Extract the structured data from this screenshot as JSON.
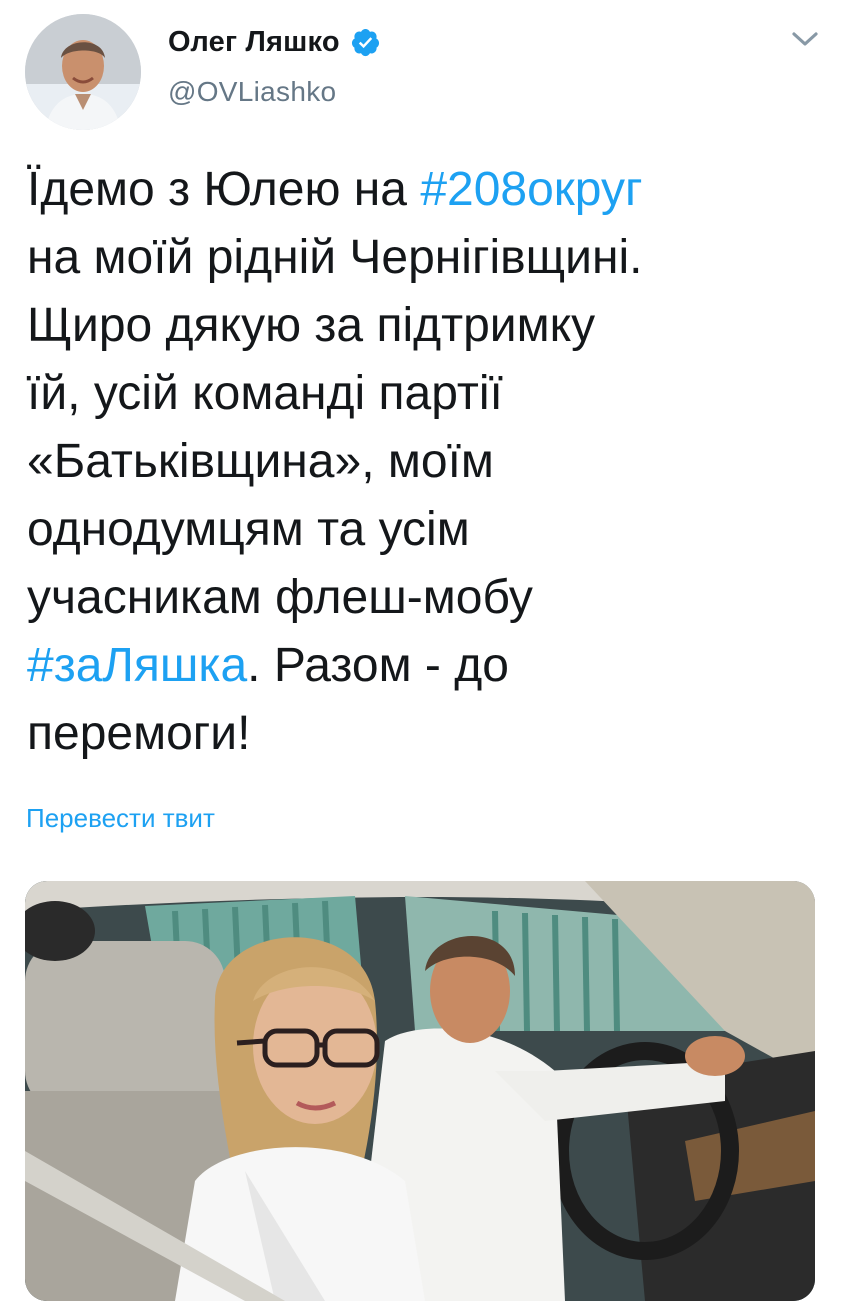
{
  "tweet": {
    "author": {
      "display_name": "Олег Ляшко",
      "handle": "@OVLiashko",
      "verified": true,
      "avatar_icon": "user-avatar-photo"
    },
    "text": {
      "line1_a": "Їдемо з Юлею на ",
      "hashtag1": "#208округ",
      "line2": "на моїй рідній Чернігівщині.",
      "line3": "Щиро дякую за підтримку",
      "line4": "їй, усій команді партії",
      "line5": "«Батьківщина», моїм",
      "line6": "однодумцям та усім",
      "line7": "учасникам флеш-мобу",
      "hashtag2": "#заЛяшка",
      "line8_b": ". Разом - до",
      "line9": "перемоги!"
    },
    "translate_link": "Перевести твит",
    "menu_icon": "chevron-down-icon"
  },
  "colors": {
    "accent": "#1da1f2",
    "text": "#14171a",
    "secondary": "#657786"
  }
}
